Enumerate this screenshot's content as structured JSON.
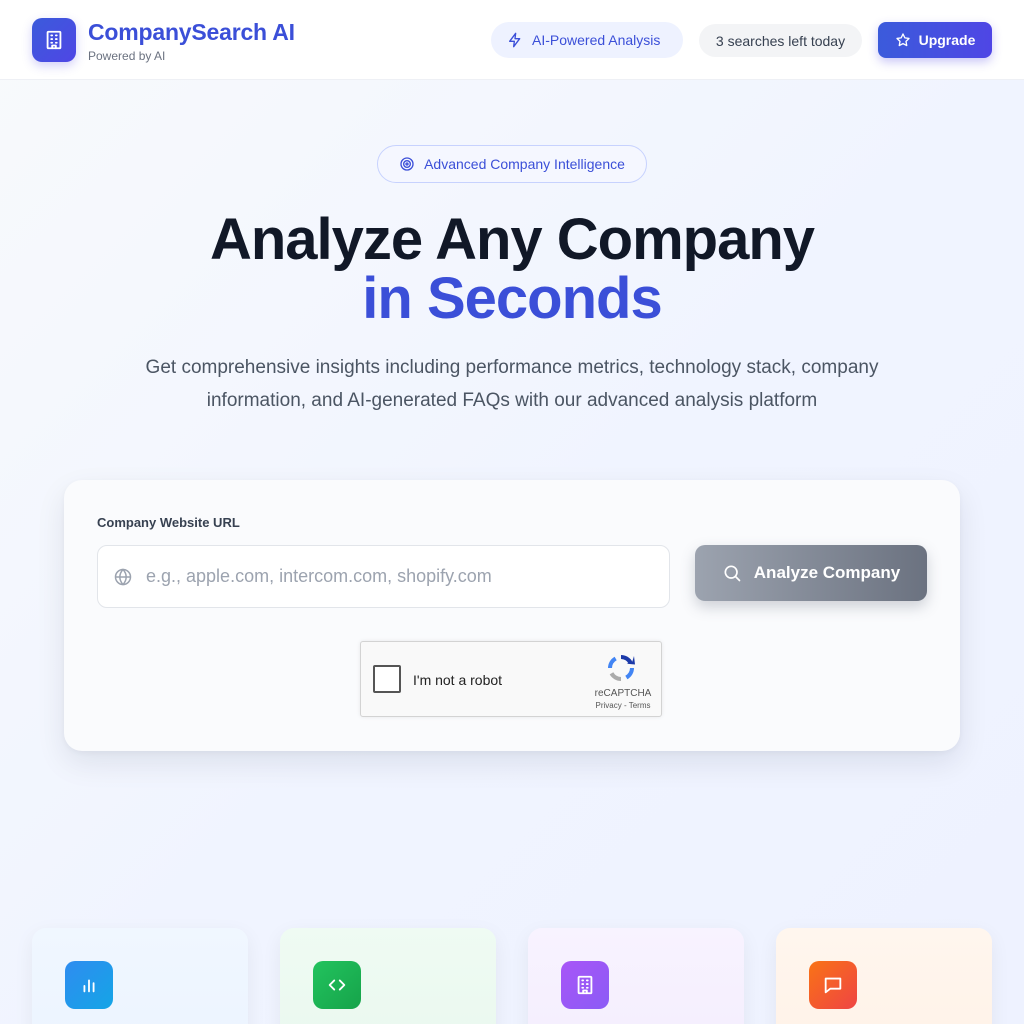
{
  "header": {
    "brand_title": "CompanySearch AI",
    "brand_subtitle": "Powered by AI",
    "logo_icon": "building-icon",
    "ai_badge_label": "AI-Powered Analysis",
    "ai_badge_icon": "lightning-icon",
    "searches_left": "3 searches left today",
    "upgrade_label": "Upgrade",
    "upgrade_icon": "star-icon"
  },
  "hero": {
    "badge_label": "Advanced Company Intelligence",
    "badge_icon": "target-icon",
    "title_line1": "Analyze Any Company",
    "title_line2": "in Seconds",
    "description": "Get comprehensive insights including performance metrics, technology stack, company information, and AI-generated FAQs with our advanced analysis platform"
  },
  "search_form": {
    "field_label": "Company Website URL",
    "url_placeholder": "e.g., apple.com, intercom.com, shopify.com",
    "url_value": "",
    "input_icon": "globe-icon",
    "analyze_label": "Analyze Company",
    "analyze_icon": "search-icon"
  },
  "recaptcha": {
    "checkbox_label": "I'm not a robot",
    "brand": "reCAPTCHA",
    "links": "Privacy - Terms"
  },
  "features": [
    {
      "icon": "bar-chart-icon"
    },
    {
      "icon": "code-icon"
    },
    {
      "icon": "building-icon"
    },
    {
      "icon": "message-icon"
    }
  ],
  "colors": {
    "accent": "#3b4fd8",
    "heading": "#111827",
    "analyze_button_gray": "#6b7280"
  }
}
